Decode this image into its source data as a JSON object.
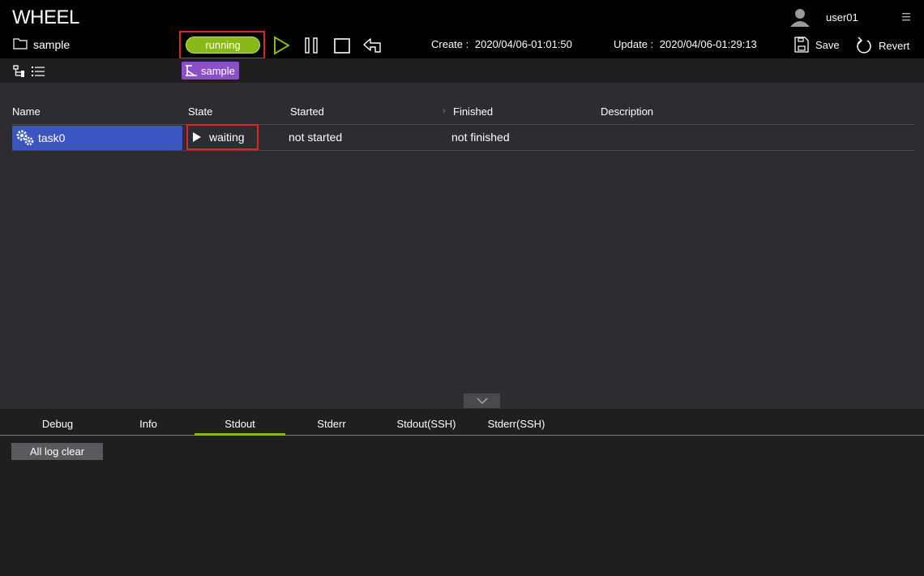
{
  "header": {
    "app_title": "WHEEL",
    "project_name": "sample",
    "status": "running",
    "create_label": "Create :",
    "create_value": "2020/04/06-01:01:50",
    "update_label": "Update :",
    "update_value": "2020/04/06-01:29:13",
    "save_label": "Save",
    "revert_label": "Revert",
    "username": "user01"
  },
  "subbar": {
    "breadcrumb": "sample"
  },
  "table": {
    "headers": {
      "name": "Name",
      "state": "State",
      "started": "Started",
      "finished": "Finished",
      "description": "Description"
    },
    "rows": [
      {
        "name": "task0",
        "state": "waiting",
        "started": "not started",
        "finished": "not finished",
        "description": ""
      }
    ]
  },
  "log": {
    "tabs": [
      "Debug",
      "Info",
      "Stdout",
      "Stderr",
      "Stdout(SSH)",
      "Stderr(SSH)"
    ],
    "active_tab": "Stdout",
    "clear_label": "All log clear"
  },
  "colors": {
    "status_running": "#88b81a",
    "task_selected": "#3a55c0",
    "breadcrumb_chip": "#8b4fc9",
    "highlight_box": "#e0242c"
  }
}
